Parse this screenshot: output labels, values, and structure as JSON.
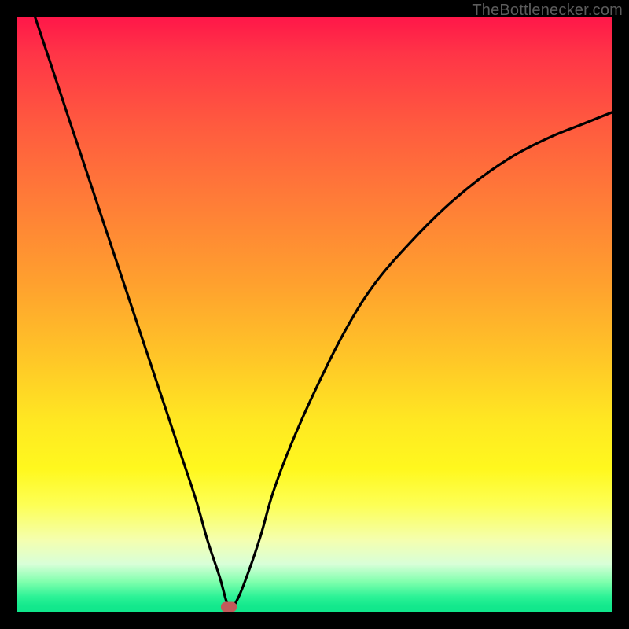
{
  "watermark": {
    "text": "TheBottlenecker.com"
  },
  "chart_data": {
    "type": "line",
    "title": "",
    "xlabel": "",
    "ylabel": "",
    "xlim": [
      0,
      100
    ],
    "ylim": [
      0,
      100
    ],
    "background_gradient": {
      "top": "#ff1749",
      "mid": "#ffe822",
      "bottom": "#10e68b"
    },
    "series": [
      {
        "name": "bottleneck-curve",
        "x": [
          3,
          6,
          9,
          12,
          15,
          18,
          21,
          24,
          27,
          30,
          32,
          34,
          35.6,
          37,
          39,
          41,
          43,
          46,
          50,
          55,
          60,
          66,
          72,
          78,
          84,
          90,
          95,
          100
        ],
        "y": [
          100,
          91,
          82,
          73,
          64,
          55,
          46,
          37,
          28,
          19,
          12,
          6,
          0.8,
          2,
          7,
          13,
          20,
          28,
          37,
          47,
          55,
          62,
          68,
          73,
          77,
          80,
          82,
          84
        ]
      }
    ],
    "marker": {
      "x": 35.6,
      "y": 0.8,
      "color": "#c25a5a"
    },
    "grid": false,
    "legend": false
  }
}
